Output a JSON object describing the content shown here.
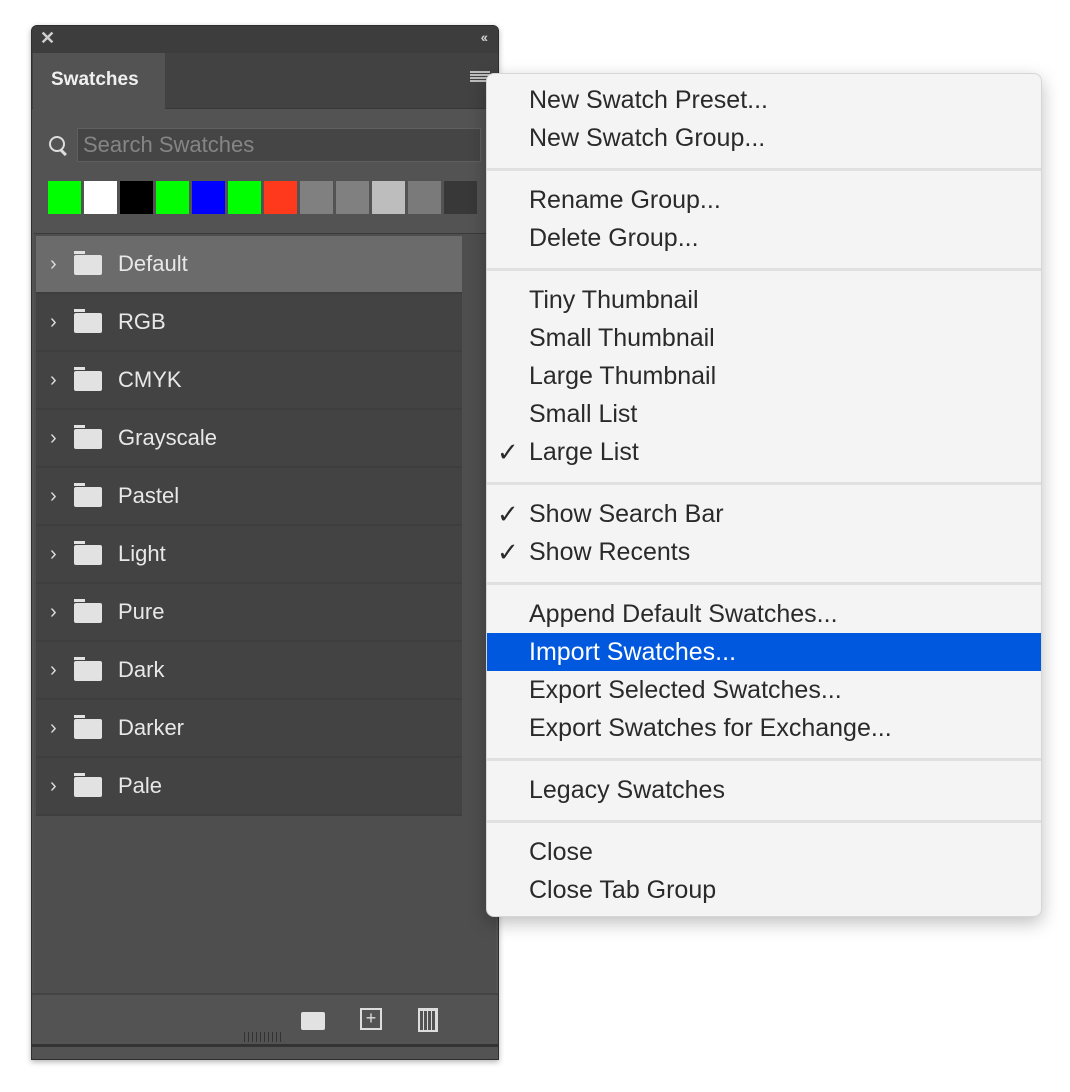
{
  "panel": {
    "tab": "Swatches",
    "search_placeholder": "Search Swatches",
    "recent_swatches": [
      "#00ff00",
      "#ffffff",
      "#000000",
      "#00ff00",
      "#0000ff",
      "#00ff00",
      "#ff3a1c",
      "#808080",
      "#808080",
      "#bdbdbd",
      "#7a7a7a",
      "#383838"
    ],
    "groups": [
      {
        "label": "Default",
        "selected": true
      },
      {
        "label": "RGB"
      },
      {
        "label": "CMYK"
      },
      {
        "label": "Grayscale"
      },
      {
        "label": "Pastel"
      },
      {
        "label": "Light"
      },
      {
        "label": "Pure"
      },
      {
        "label": "Dark"
      },
      {
        "label": "Darker"
      },
      {
        "label": "Pale"
      }
    ],
    "footer_buttons": [
      "new-group",
      "new-swatch",
      "delete"
    ]
  },
  "menu": {
    "sections": [
      [
        {
          "label": "New Swatch Preset..."
        },
        {
          "label": "New Swatch Group..."
        }
      ],
      [
        {
          "label": "Rename Group..."
        },
        {
          "label": "Delete Group..."
        }
      ],
      [
        {
          "label": "Tiny Thumbnail"
        },
        {
          "label": "Small Thumbnail"
        },
        {
          "label": "Large Thumbnail"
        },
        {
          "label": "Small List"
        },
        {
          "label": "Large List",
          "checked": true
        }
      ],
      [
        {
          "label": "Show Search Bar",
          "checked": true
        },
        {
          "label": "Show Recents",
          "checked": true
        }
      ],
      [
        {
          "label": "Append Default Swatches..."
        },
        {
          "label": "Import Swatches...",
          "highlighted": true
        },
        {
          "label": "Export Selected Swatches..."
        },
        {
          "label": "Export Swatches for Exchange..."
        }
      ],
      [
        {
          "label": "Legacy Swatches"
        }
      ],
      [
        {
          "label": "Close"
        },
        {
          "label": "Close Tab Group"
        }
      ]
    ],
    "check_glyph": "✓",
    "highlight_color": "#0058df"
  }
}
